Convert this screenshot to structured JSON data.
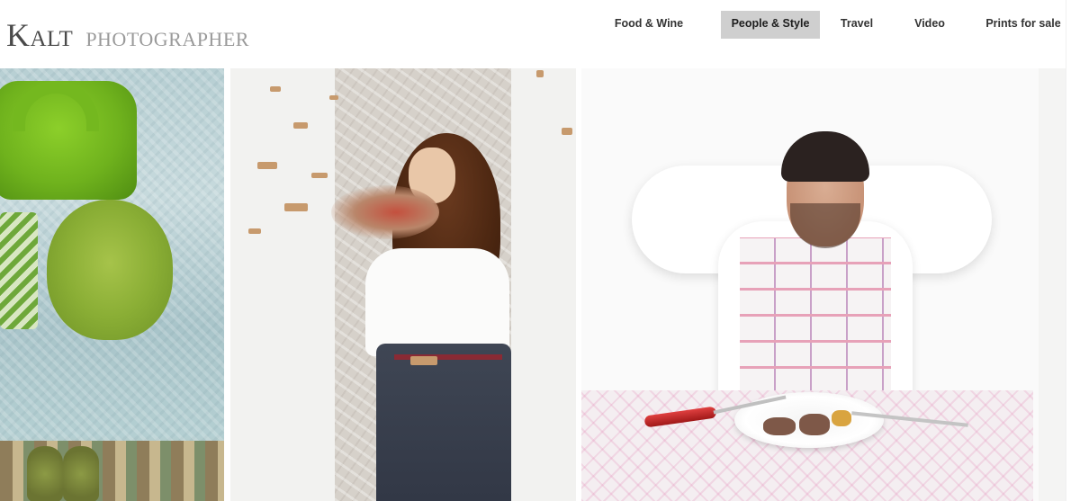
{
  "brand": {
    "name": "Kalt",
    "tagline": "PHOTOGRAPHER"
  },
  "nav": {
    "items": [
      {
        "label": "Food & Wine",
        "active": false
      },
      {
        "label": "People & Style",
        "active": true
      },
      {
        "label": "Travel",
        "active": false
      },
      {
        "label": "Video",
        "active": false
      },
      {
        "label": "Prints for sale",
        "active": false
      }
    ]
  },
  "colors": {
    "brand_text": "#4a4a4a",
    "tagline_text": "#9a9a9a",
    "nav_active_bg": "#cfcfcf",
    "nav_text": "#333333"
  }
}
